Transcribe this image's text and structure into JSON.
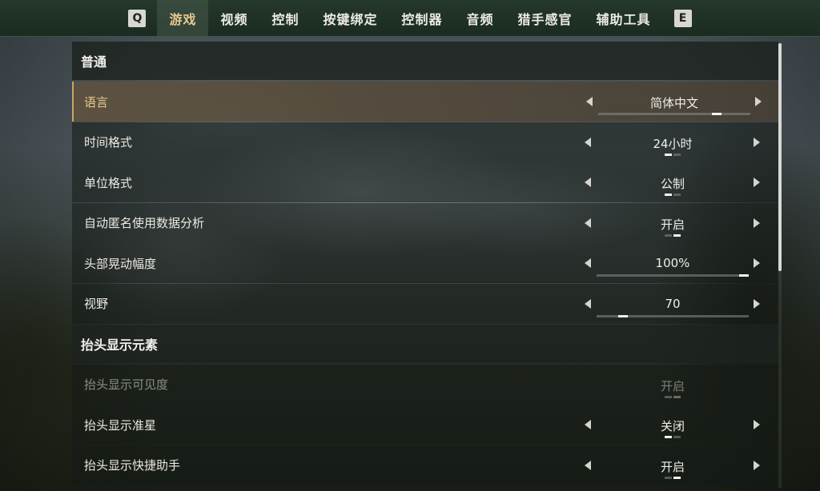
{
  "tabs": {
    "prev_key": "Q",
    "next_key": "E",
    "items": [
      {
        "label": "游戏"
      },
      {
        "label": "视频"
      },
      {
        "label": "控制"
      },
      {
        "label": "按键绑定"
      },
      {
        "label": "控制器"
      },
      {
        "label": "音频"
      },
      {
        "label": "猎手感官"
      },
      {
        "label": "辅助工具"
      }
    ]
  },
  "sections": {
    "general": {
      "title": "普通",
      "language": {
        "label": "语言",
        "value": "简体中文",
        "slider_fraction": 0.8
      },
      "time_format": {
        "label": "时间格式",
        "value": "24小时",
        "option_index": 0,
        "option_count": 2
      },
      "unit_format": {
        "label": "单位格式",
        "value": "公制",
        "option_index": 0,
        "option_count": 2
      },
      "analytics": {
        "label": "自动匿名使用数据分析",
        "value": "开启",
        "option_index": 1,
        "option_count": 2
      },
      "head_bob": {
        "label": "头部晃动幅度",
        "value": "100%",
        "slider_fraction": 1.0
      },
      "fov": {
        "label": "视野",
        "value": "70",
        "slider_fraction": 0.15
      }
    },
    "hud": {
      "title": "抬头显示元素",
      "hud_visibility": {
        "label": "抬头显示可见度",
        "value": "开启",
        "option_index": 1,
        "option_count": 2
      },
      "crosshair": {
        "label": "抬头显示准星",
        "value": "关闭",
        "option_index": 0,
        "option_count": 2
      },
      "quick_helper": {
        "label": "抬头显示快捷助手",
        "value": "开启",
        "option_index": 1,
        "option_count": 2
      }
    }
  },
  "colors": {
    "accent": "#e7c98e",
    "topbar": "#1f3126",
    "selected_row": "#5f523e"
  }
}
